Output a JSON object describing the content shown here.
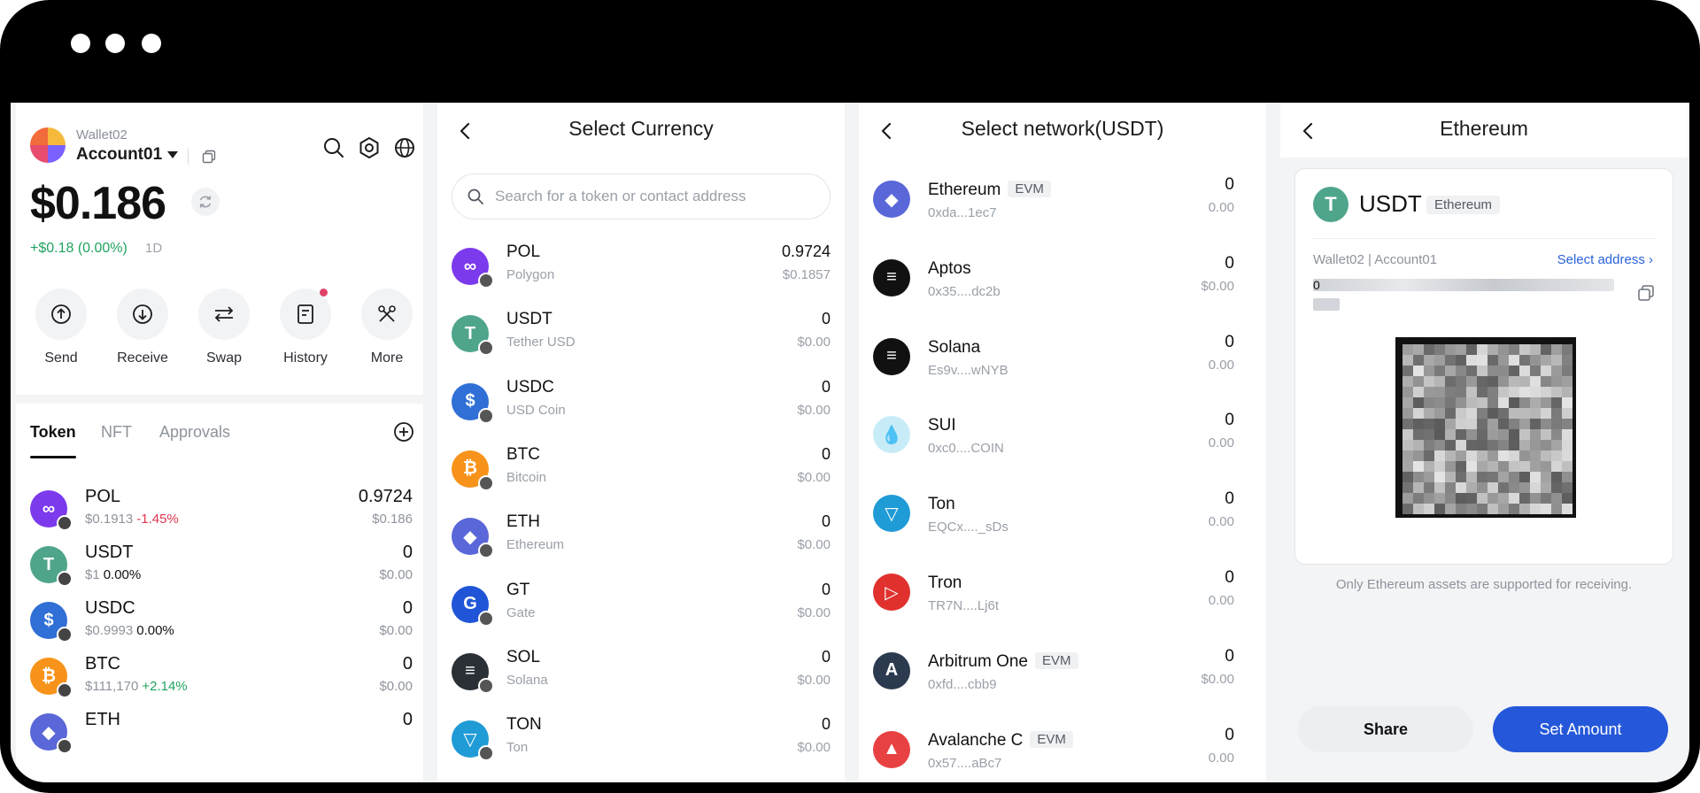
{
  "wallet": {
    "wallet_name": "Wallet02",
    "account_name": "Account01",
    "balance": "$0.186",
    "change": "+$0.18 (0.00%)",
    "change_period": "1D",
    "actions": [
      {
        "label": "Send",
        "icon": "send-icon"
      },
      {
        "label": "Receive",
        "icon": "receive-icon"
      },
      {
        "label": "Swap",
        "icon": "swap-icon"
      },
      {
        "label": "History",
        "icon": "history-icon"
      },
      {
        "label": "More",
        "icon": "more-tools-icon"
      }
    ],
    "tabs": [
      "Token",
      "NFT",
      "Approvals"
    ],
    "tokens": [
      {
        "symbol": "POL",
        "price": "$0.1913",
        "pct": "-1.45%",
        "amount": "0.9724",
        "value": "$0.186",
        "color": "#7c3aed"
      },
      {
        "symbol": "USDT",
        "price": "$1",
        "pct": "0.00%",
        "amount": "0",
        "value": "$0.00",
        "color": "#4fa58b"
      },
      {
        "symbol": "USDC",
        "price": "$0.9993",
        "pct": "0.00%",
        "amount": "0",
        "value": "$0.00",
        "color": "#2f6fd6"
      },
      {
        "symbol": "BTC",
        "price": "$111,170",
        "pct": "+2.14%",
        "amount": "0",
        "value": "$0.00",
        "color": "#f7931a"
      },
      {
        "symbol": "ETH",
        "price": "",
        "pct": "",
        "amount": "0",
        "value": "",
        "color": "#5a67d8"
      }
    ]
  },
  "select_currency": {
    "title": "Select Currency",
    "search_placeholder": "Search for a token or contact address",
    "items": [
      {
        "symbol": "POL",
        "name": "Polygon",
        "amount": "0.9724",
        "value": "$0.1857",
        "color": "#7c3aed"
      },
      {
        "symbol": "USDT",
        "name": "Tether USD",
        "amount": "0",
        "value": "$0.00",
        "color": "#4fa58b"
      },
      {
        "symbol": "USDC",
        "name": "USD Coin",
        "amount": "0",
        "value": "$0.00",
        "color": "#2f6fd6"
      },
      {
        "symbol": "BTC",
        "name": "Bitcoin",
        "amount": "0",
        "value": "$0.00",
        "color": "#f7931a"
      },
      {
        "symbol": "ETH",
        "name": "Ethereum",
        "amount": "0",
        "value": "$0.00",
        "color": "#5a67d8"
      },
      {
        "symbol": "GT",
        "name": "Gate",
        "amount": "0",
        "value": "$0.00",
        "color": "#1f55d6"
      },
      {
        "symbol": "SOL",
        "name": "Solana",
        "amount": "0",
        "value": "$0.00",
        "color": "#2b2f36"
      },
      {
        "symbol": "TON",
        "name": "Ton",
        "amount": "0",
        "value": "$0.00",
        "color": "#1f9bd6"
      }
    ]
  },
  "select_network": {
    "title": "Select network(USDT)",
    "items": [
      {
        "name": "Ethereum",
        "tag": "EVM",
        "address": "0xda...1ec7",
        "amount": "0",
        "value": "0.00",
        "color": "#5a67d8"
      },
      {
        "name": "Aptos",
        "tag": "",
        "address": "0x35....dc2b",
        "amount": "0",
        "value": "$0.00",
        "color": "#111111"
      },
      {
        "name": "Solana",
        "tag": "",
        "address": "Es9v....wNYB",
        "amount": "0",
        "value": "0.00",
        "color": "#111111"
      },
      {
        "name": "SUI",
        "tag": "",
        "address": "0xc0....COIN",
        "amount": "0",
        "value": "0.00",
        "color": "#c8ecf7"
      },
      {
        "name": "Ton",
        "tag": "",
        "address": "EQCx...._sDs",
        "amount": "0",
        "value": "0.00",
        "color": "#1f9bd6"
      },
      {
        "name": "Tron",
        "tag": "",
        "address": "TR7N....Lj6t",
        "amount": "0",
        "value": "0.00",
        "color": "#e0312f"
      },
      {
        "name": "Arbitrum One",
        "tag": "EVM",
        "address": "0xfd....cbb9",
        "amount": "0",
        "value": "$0.00",
        "color": "#2c3a4f"
      },
      {
        "name": "Avalanche C",
        "tag": "EVM",
        "address": "0x57....aBc7",
        "amount": "0",
        "value": "0.00",
        "color": "#e84142"
      }
    ]
  },
  "receive": {
    "title": "Ethereum",
    "token_symbol": "USDT",
    "network_tag": "Ethereum",
    "wallet_account": "Wallet02 | Account01",
    "select_address": "Select address",
    "address_start": "0",
    "note": "Only Ethereum assets are supported for receiving.",
    "share_label": "Share",
    "set_amount_label": "Set Amount"
  },
  "colors": {
    "accent": "#2457d9",
    "positive": "#20a35f",
    "negative": "#e0364f"
  }
}
